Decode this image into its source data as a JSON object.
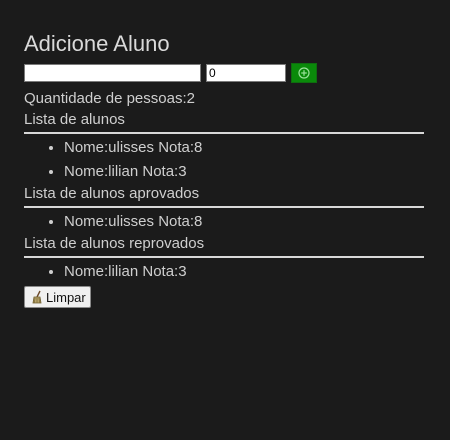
{
  "header": {
    "title": "Adicione Aluno"
  },
  "form": {
    "name_value": "",
    "grade_value": "0",
    "add_icon": "plus-circle-icon"
  },
  "summary": {
    "count_text": "Quantidade de pessoas:2"
  },
  "sections": {
    "all": {
      "title": "Lista de alunos",
      "items": [
        "Nome:ulisses Nota:8",
        "Nome:lilian Nota:3"
      ]
    },
    "approved": {
      "title": "Lista de alunos aprovados",
      "items": [
        "Nome:ulisses Nota:8"
      ]
    },
    "failed": {
      "title": "Lista de alunos reprovados",
      "items": [
        "Nome:lilian Nota:3"
      ]
    }
  },
  "actions": {
    "clear_label": "Limpar",
    "clear_icon": "broom-icon"
  },
  "colors": {
    "background": "#1b1b1b",
    "text": "#cfcfcf",
    "add_button": "#0a8a0a",
    "divider": "#d8d8d8"
  }
}
